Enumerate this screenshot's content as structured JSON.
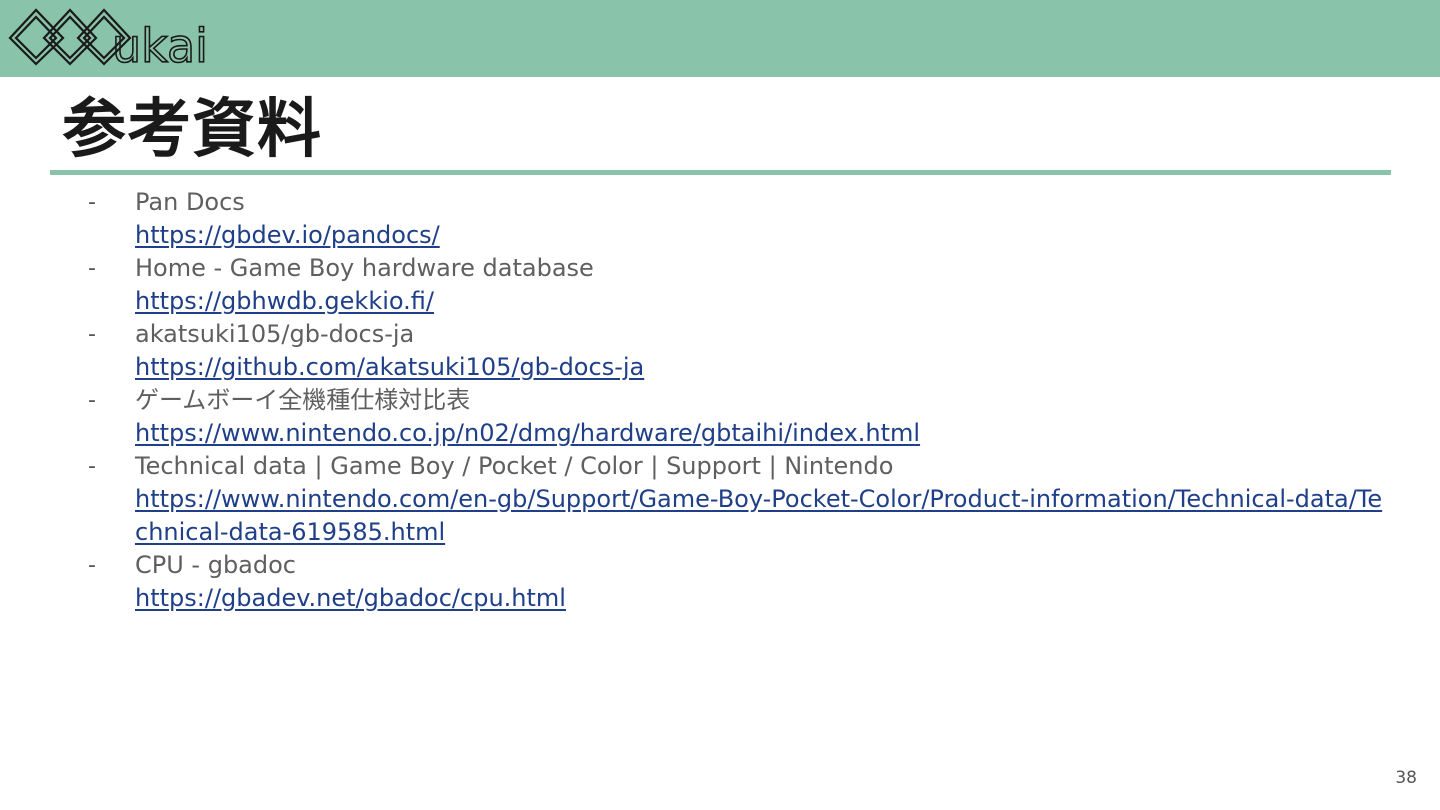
{
  "logo": {
    "text": "ukai",
    "icon": "diamond-chain-logo-icon"
  },
  "slide": {
    "title": "参考資料",
    "bullet": "-",
    "page_number": "38"
  },
  "references": [
    {
      "title": "Pan Docs",
      "url": "https://gbdev.io/pandocs/"
    },
    {
      "title": "Home - Game Boy hardware database",
      "url": "https://gbhwdb.gekkio.fi/"
    },
    {
      "title": "akatsuki105/gb-docs-ja",
      "url": "https://github.com/akatsuki105/gb-docs-ja"
    },
    {
      "title": "ゲームボーイ全機種仕様対比表",
      "url": "https://www.nintendo.co.jp/n02/dmg/hardware/gbtaihi/index.html"
    },
    {
      "title": "Technical data | Game Boy / Pocket / Color | Support | Nintendo",
      "url": "https://www.nintendo.com/en-gb/Support/Game-Boy-Pocket-Color/Product-information/Technical-data/Technical-data-619585.html"
    },
    {
      "title": "CPU - gbadoc",
      "url": "https://gbadev.net/gbadoc/cpu.html"
    }
  ],
  "colors": {
    "header_band": "#89c3aa",
    "title_rule": "#89c3aa",
    "link": "#1f3f88",
    "text": "#5f5f5f"
  }
}
